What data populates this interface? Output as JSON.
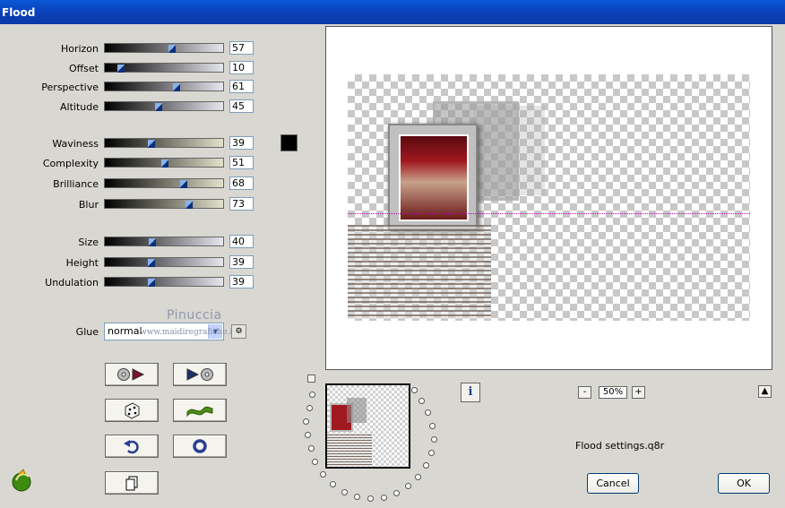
{
  "window": {
    "title": "Flood"
  },
  "sliders": [
    {
      "label": "Horizon",
      "value": "57"
    },
    {
      "label": "Offset",
      "value": "10"
    },
    {
      "label": "Perspective",
      "value": "61"
    },
    {
      "label": "Altitude",
      "value": "45"
    },
    {
      "label": "Waviness",
      "value": "39"
    },
    {
      "label": "Complexity",
      "value": "51"
    },
    {
      "label": "Brilliance",
      "value": "68"
    },
    {
      "label": "Blur",
      "value": "73"
    },
    {
      "label": "Size",
      "value": "40"
    },
    {
      "label": "Height",
      "value": "39"
    },
    {
      "label": "Undulation",
      "value": "39"
    }
  ],
  "color": {
    "flood_color": "#000000",
    "accent": "#0b47c4"
  },
  "glue": {
    "label": "Glue",
    "value": "normal"
  },
  "watermark": {
    "line1": "Pinuccia",
    "line2": "www.maidiregrafiche.it"
  },
  "buttons": [
    {
      "icon": "load-previous-icon"
    },
    {
      "icon": "load-next-icon"
    },
    {
      "icon": "dice-randomize-icon"
    },
    {
      "icon": "wave-icon"
    },
    {
      "icon": "undo-icon"
    },
    {
      "icon": "reset-icon"
    },
    {
      "icon": "copy-icon"
    }
  ],
  "preview": {
    "zoom": "50%",
    "zoom_minus": "-",
    "zoom_plus": "+",
    "info": "i"
  },
  "settings_file": "Flood settings.q8r",
  "dialog": {
    "cancel": "Cancel",
    "ok": "OK"
  }
}
